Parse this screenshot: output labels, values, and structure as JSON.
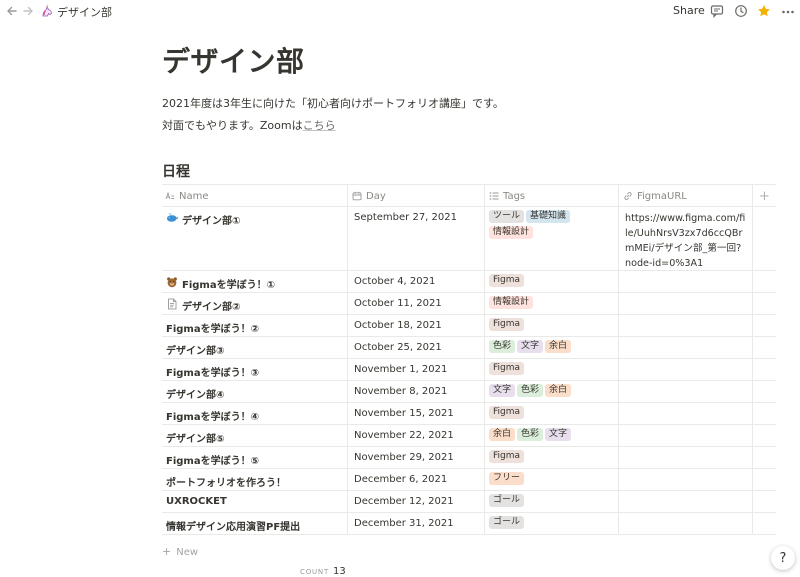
{
  "topbar": {
    "breadcrumb_label": "デザイン部",
    "share_label": "Share",
    "back_icon": "arrow-left-icon",
    "forward_icon": "arrow-right-icon",
    "comment_icon": "comment-icon",
    "history_icon": "clock-icon",
    "favorite_icon": "star-icon",
    "more_icon": "more-icon",
    "star_color": "#f5b100"
  },
  "page": {
    "title": "デザイン部",
    "para1": "2021年度は3年生に向けた「初心者向けポートフォリオ講座」です。",
    "para2_prefix": "対面でもやります。Zoomは",
    "para2_link": "こちら",
    "section_title": "日程"
  },
  "table": {
    "headers": {
      "name": "Name",
      "day": "Day",
      "tags": "Tags",
      "url": "FigmaURL",
      "add": "+"
    },
    "rows": [
      {
        "name": "デザイン部①",
        "icon": "whale-icon",
        "day": "September 27, 2021",
        "tags": [
          {
            "label": "ツール",
            "color": "#e3e2e0"
          },
          {
            "label": "基礎知識",
            "color": "#d3e5ef"
          },
          {
            "label": "情報設計",
            "color": "#ffe2dd"
          }
        ],
        "url": "https://www.figma.com/file/UuhNrsV3zx7d6ccQBrmMEi/デザイン部_第一回?node-id=0%3A1"
      },
      {
        "name": "Figmaを学ぼう！①",
        "icon": "bear-icon",
        "day": "October 4, 2021",
        "tags": [
          {
            "label": "Figma",
            "color": "#eee0da"
          }
        ],
        "url": ""
      },
      {
        "name": "デザイン部②",
        "icon": "document-icon",
        "day": "October 11, 2021",
        "tags": [
          {
            "label": "情報設計",
            "color": "#ffe2dd"
          }
        ],
        "url": ""
      },
      {
        "name": "Figmaを学ぼう！②",
        "icon": "",
        "day": "October 18, 2021",
        "tags": [
          {
            "label": "Figma",
            "color": "#eee0da"
          }
        ],
        "url": ""
      },
      {
        "name": "デザイン部③",
        "icon": "",
        "day": "October 25, 2021",
        "tags": [
          {
            "label": "色彩",
            "color": "#dbeddb"
          },
          {
            "label": "文字",
            "color": "#e8deee"
          },
          {
            "label": "余白",
            "color": "#fadec9"
          }
        ],
        "url": ""
      },
      {
        "name": "Figmaを学ぼう！③",
        "icon": "",
        "day": "November 1, 2021",
        "tags": [
          {
            "label": "Figma",
            "color": "#eee0da"
          }
        ],
        "url": ""
      },
      {
        "name": "デザイン部④",
        "icon": "",
        "day": "November 8, 2021",
        "tags": [
          {
            "label": "文字",
            "color": "#e8deee"
          },
          {
            "label": "色彩",
            "color": "#dbeddb"
          },
          {
            "label": "余白",
            "color": "#fadec9"
          }
        ],
        "url": ""
      },
      {
        "name": "Figmaを学ぼう！④",
        "icon": "",
        "day": "November 15, 2021",
        "tags": [
          {
            "label": "Figma",
            "color": "#eee0da"
          }
        ],
        "url": ""
      },
      {
        "name": "デザイン部⑤",
        "icon": "",
        "day": "November 22, 2021",
        "tags": [
          {
            "label": "余白",
            "color": "#fadec9"
          },
          {
            "label": "色彩",
            "color": "#dbeddb"
          },
          {
            "label": "文字",
            "color": "#e8deee"
          }
        ],
        "url": ""
      },
      {
        "name": "Figmaを学ぼう！⑤",
        "icon": "",
        "day": "November 29, 2021",
        "tags": [
          {
            "label": "Figma",
            "color": "#eee0da"
          }
        ],
        "url": ""
      },
      {
        "name": "ポートフォリオを作ろう！",
        "icon": "",
        "day": "December 6, 2021",
        "tags": [
          {
            "label": "フリー",
            "color": "#fadec9"
          }
        ],
        "url": ""
      },
      {
        "name": "UXROCKET",
        "icon": "",
        "day": "December 12, 2021",
        "tags": [
          {
            "label": "ゴール",
            "color": "#e3e2e0"
          }
        ],
        "url": ""
      },
      {
        "name": "情報デザイン応用演習PF提出",
        "icon": "",
        "day": "December 31, 2021",
        "tags": [
          {
            "label": "ゴール",
            "color": "#e3e2e0"
          }
        ],
        "url": ""
      }
    ],
    "new_label": "New",
    "count_label": "COUNT",
    "count_value": "13"
  },
  "help_label": "?"
}
